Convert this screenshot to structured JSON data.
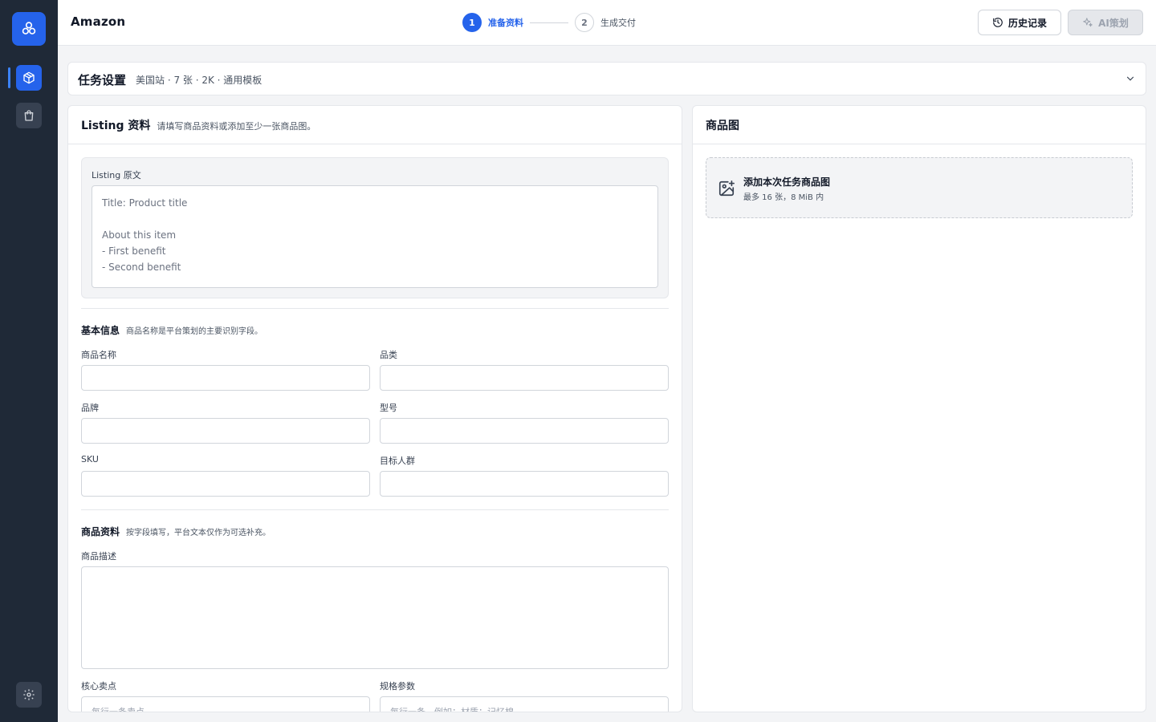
{
  "app": {
    "title": "Amazon"
  },
  "colors": {
    "accent": "#2563eb",
    "rail": "#1f2937",
    "background": "#f3f4f6"
  },
  "rail": {
    "logo_icon": "flower-logo-icon",
    "items": [
      {
        "icon": "package-icon",
        "active": true
      },
      {
        "icon": "shopping-bag-icon",
        "active": false
      }
    ],
    "settings_icon": "gear-icon"
  },
  "steps": [
    {
      "num": "1",
      "label": "准备资料",
      "active": true
    },
    {
      "num": "2",
      "label": "生成交付",
      "active": false
    }
  ],
  "header": {
    "history_label": "历史记录",
    "history_icon": "history-icon",
    "ai_label": "AI策划",
    "ai_icon": "sparkle-icon",
    "ai_disabled": true
  },
  "task": {
    "title": "任务设置",
    "meta": "美国站 · 7 张 · 2K · 通用模板"
  },
  "listing_panel": {
    "title": "Listing 资料",
    "subtitle": "请填写商品资料或添加至少一张商品图。",
    "source_label": "Listing 原文",
    "source_placeholder": "Title: Product title\n\nAbout this item\n- First benefit\n- Second benefit",
    "basic": {
      "title": "基本信息",
      "subtitle": "商品名称是平台策划的主要识别字段。",
      "fields": {
        "name": {
          "label": "商品名称",
          "value": ""
        },
        "category": {
          "label": "品类",
          "value": ""
        },
        "brand": {
          "label": "品牌",
          "value": ""
        },
        "model": {
          "label": "型号",
          "value": ""
        },
        "sku": {
          "label": "SKU",
          "value": ""
        },
        "audience": {
          "label": "目标人群",
          "value": ""
        }
      }
    },
    "product": {
      "title": "商品资料",
      "subtitle": "按字段填写，平台文本仅作为可选补充。",
      "description_label": "商品描述",
      "description_value": "",
      "selling_points_label": "核心卖点",
      "selling_points_placeholder": "每行一条卖点",
      "specs_label": "规格参数",
      "specs_placeholder": "每行一条，例如：材质：记忆棉"
    }
  },
  "image_panel": {
    "title": "商品图",
    "upload_title": "添加本次任务商品图",
    "upload_subtitle": "最多 16 张，8 MiB 内",
    "upload_icon": "image-plus-icon"
  }
}
